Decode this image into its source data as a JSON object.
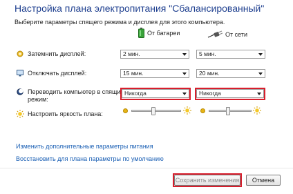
{
  "page": {
    "title": "Настройка плана электропитания \"Сбалансированный\"",
    "subtitle": "Выберите параметры спящего режима и дисплея для этого компьютера."
  },
  "columns": {
    "battery": {
      "label": "От батареи",
      "icon": "battery-icon"
    },
    "plugged": {
      "label": "От сети",
      "icon": "power-plug-icon"
    }
  },
  "rows": [
    {
      "label": "Затемнить дисплей:",
      "icon": "dim-display-icon",
      "battery": "2 мин.",
      "plugged": "5 мин."
    },
    {
      "label": "Отключать дисплей:",
      "icon": "display-off-icon",
      "battery": "15 мин.",
      "plugged": "20 мин."
    },
    {
      "label_line1": "Переводить компьютер в спящий",
      "label_line2": "режим:",
      "icon": "sleep-icon",
      "battery": "Никогда",
      "plugged": "Никогда"
    }
  ],
  "brightness": {
    "label": "Настроить яркость плана:",
    "icon": "brightness-icon",
    "battery_level": 0.45,
    "plugged_level": 0.45
  },
  "links": {
    "advanced": "Изменить дополнительные параметры питания",
    "restore": "Восстановить для плана параметры по умолчанию"
  },
  "buttons": {
    "save": "Сохранить изменения",
    "cancel": "Отмена"
  },
  "colors": {
    "title": "#1e3f8f",
    "link": "#1a5fb4",
    "highlight": "#d81e2c"
  }
}
